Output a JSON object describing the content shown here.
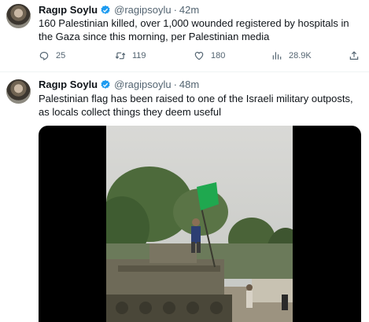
{
  "tweets": [
    {
      "author": "Ragıp Soylu",
      "handle": "@ragipsoylu",
      "separator": "·",
      "time": "42m",
      "text": "160 Palestinian killed, over 1,000 wounded registered by hospitals in the Gaza since this morning, per Palestinian media",
      "actions": {
        "replies": "25",
        "retweets": "119",
        "likes": "180",
        "views": "28.9K"
      }
    },
    {
      "author": "Ragıp Soylu",
      "handle": "@ragipsoylu",
      "separator": "·",
      "time": "48m",
      "text": "Palestinian flag has been raised to one of the Israeli military outposts, as locals collect things they deem useful"
    }
  ],
  "colors": {
    "verified": "#1d9bf0",
    "secondary_text": "#536471",
    "flag": "#1fa84f"
  },
  "icons": [
    "verified-badge-icon",
    "reply-icon",
    "retweet-icon",
    "like-icon",
    "views-icon",
    "share-icon"
  ]
}
